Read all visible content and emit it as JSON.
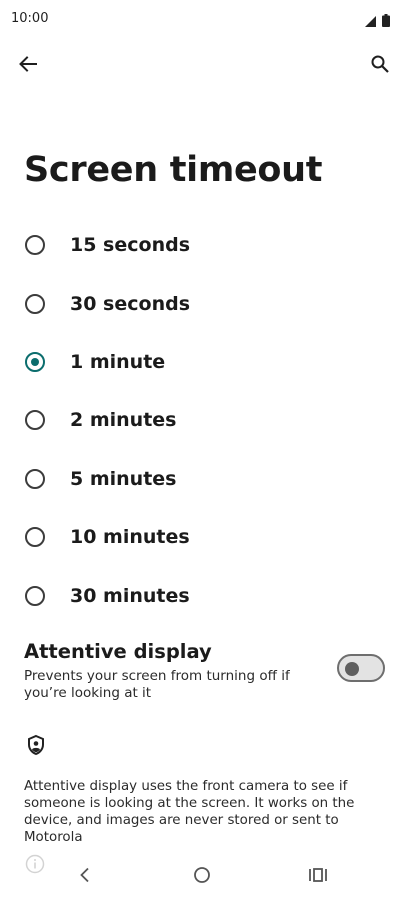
{
  "status_bar": {
    "time": "10:00",
    "icons": [
      "signal-icon",
      "battery-icon"
    ]
  },
  "top_bar": {
    "back_icon": "arrow-back-icon",
    "search_icon": "search-icon"
  },
  "title": "Screen timeout",
  "options": [
    {
      "label": "15 seconds",
      "selected": false
    },
    {
      "label": "30 seconds",
      "selected": false
    },
    {
      "label": "1 minute",
      "selected": true
    },
    {
      "label": "2 minutes",
      "selected": false
    },
    {
      "label": "5 minutes",
      "selected": false
    },
    {
      "label": "10 minutes",
      "selected": false
    },
    {
      "label": "30 minutes",
      "selected": false
    }
  ],
  "attentive_display": {
    "title": "Attentive display",
    "summary": "Prevents your screen from turning off if you’re looking at it",
    "enabled": false
  },
  "privacy_icon": "shield-person-icon",
  "footer_text": "Attentive display uses the front camera to see if someone is looking at the screen. It works on the device, and images are never stored or sent to Motorola",
  "info_icon": "info-icon",
  "nav_bar": {
    "back_icon": "nav-back-icon",
    "home_icon": "nav-home-icon",
    "recents_icon": "nav-recents-icon"
  },
  "colors": {
    "accent": "#0b6d6d",
    "text": "#1b1b1b",
    "background": "#ffffff"
  }
}
